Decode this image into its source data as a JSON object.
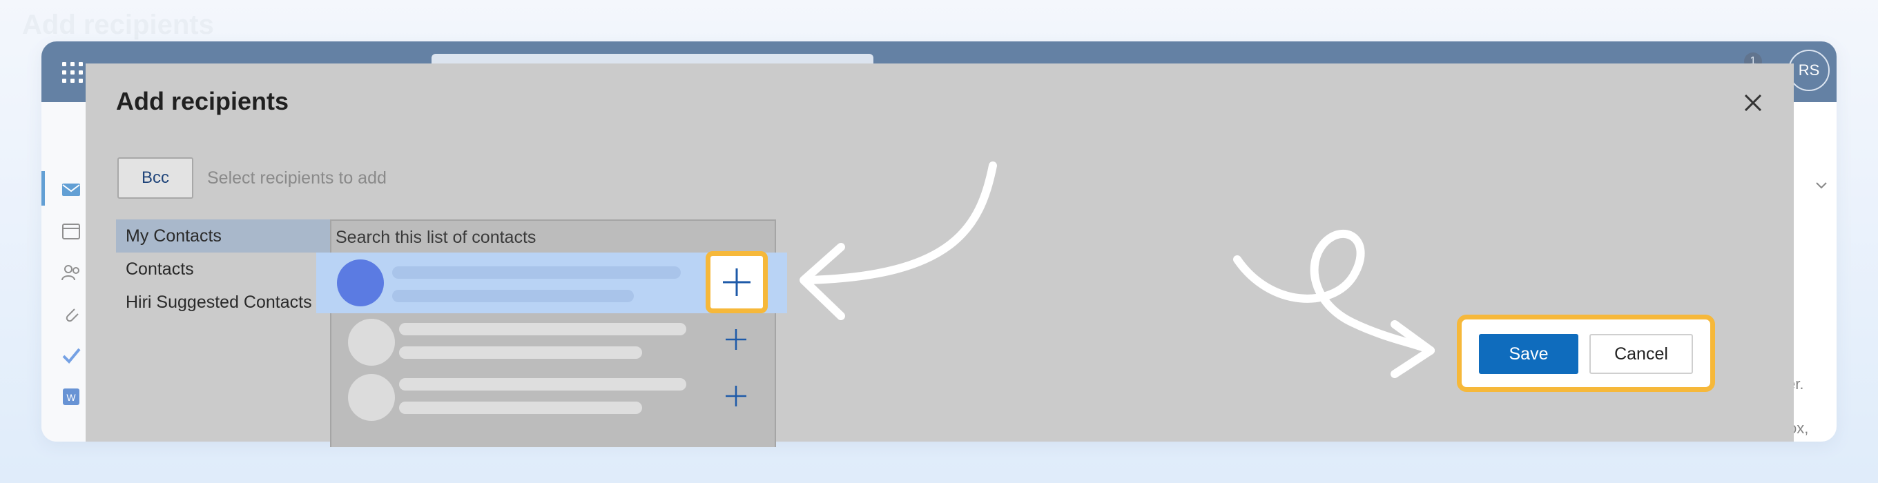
{
  "background": {
    "title": "Add recipients"
  },
  "app": {
    "user_initials": "RS",
    "notification_count": "1",
    "right_text_peek": "er.",
    "right_text_peek2": "ox,",
    "word_icon_letter": "W"
  },
  "dialog": {
    "title": "Add recipients",
    "bcc_label": "Bcc",
    "recipients_placeholder": "Select recipients to add",
    "sources": [
      {
        "label": "My Contacts",
        "selected": true
      },
      {
        "label": "Contacts",
        "selected": false
      },
      {
        "label": "Hiri Suggested Contacts",
        "selected": false
      }
    ],
    "contacts_search_placeholder": "Search this list of contacts",
    "save_label": "Save",
    "cancel_label": "Cancel"
  },
  "colors": {
    "topbar": "#123e73",
    "accent": "#0f6cbd",
    "highlight": "#f6b83a",
    "selected_row": "#b9d3f5"
  }
}
